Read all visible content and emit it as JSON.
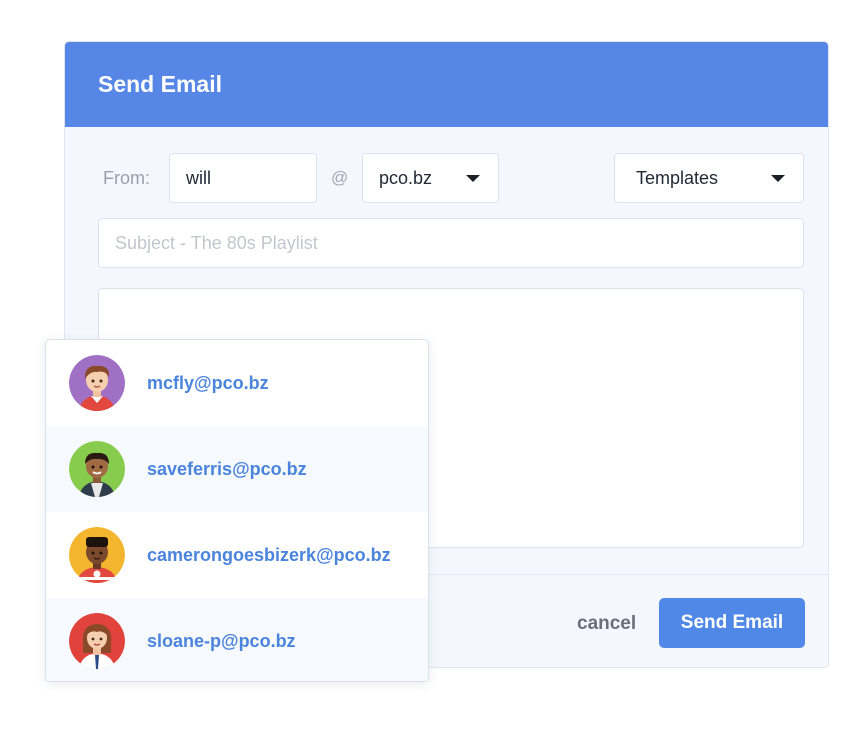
{
  "dialog": {
    "title": "Send Email",
    "from_label": "From:",
    "from_value": "will",
    "at_sign": "@",
    "domain_value": "pco.bz",
    "templates_label": "Templates",
    "subject_placeholder": "Subject - The 80s Playlist",
    "cancel_label": "cancel",
    "send_label": "Send Email"
  },
  "suggestions": [
    {
      "email": "mcfly@pco.bz",
      "avatar_color": "#a070c4",
      "icon": "avatar-boy-red-shirt-icon"
    },
    {
      "email": "saveferris@pco.bz",
      "avatar_color": "#88cc4e",
      "icon": "avatar-boy-vest-icon"
    },
    {
      "email": "camerongoesbizerk@pco.bz",
      "avatar_color": "#f5b62f",
      "icon": "avatar-boy-jersey-icon"
    },
    {
      "email": "sloane-p@pco.bz",
      "avatar_color": "#e1433c",
      "icon": "avatar-girl-icon"
    }
  ],
  "colors": {
    "header": "#5686e6",
    "accent": "#4f88e6",
    "link": "#4a84dc"
  }
}
